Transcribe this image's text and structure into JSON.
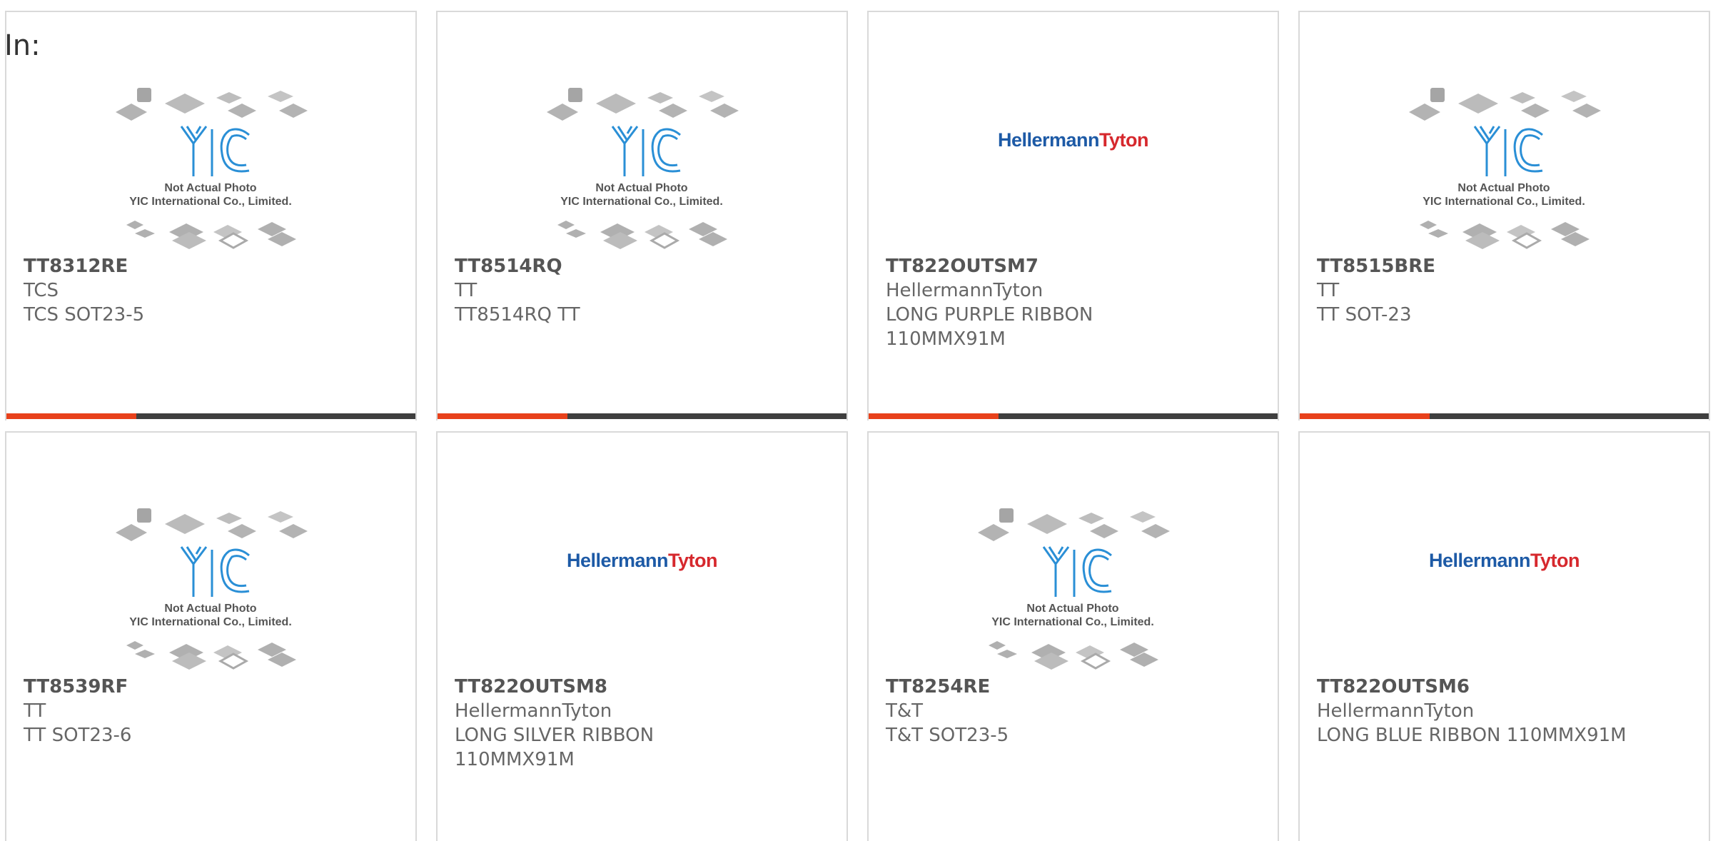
{
  "filter_label": "In:",
  "placeholder": {
    "caption_line1": "Not Actual Photo",
    "caption_line2": "YIC International Co., Limited.",
    "logo_text": "YIC"
  },
  "brand_logo": {
    "part1": "Hellermann",
    "part2": "Tyton"
  },
  "colors": {
    "accent": "#e8411b",
    "bar": "#3f3f3f",
    "logo_blue": "#1d5aa6",
    "logo_red": "#d6282d"
  },
  "products": [
    {
      "part": "TT8312RE",
      "mfr": "TCS",
      "desc": "TCS SOT23-5",
      "image": "yic-placeholder"
    },
    {
      "part": "TT8514RQ",
      "mfr": "TT",
      "desc": "TT8514RQ TT",
      "image": "yic-placeholder"
    },
    {
      "part": "TT822OUTSM7",
      "mfr": "HellermannTyton",
      "desc": "LONG PURPLE RIBBON 110MMX91M",
      "image": "hellermanntyton-logo"
    },
    {
      "part": "TT8515BRE",
      "mfr": "TT",
      "desc": "TT SOT-23",
      "image": "yic-placeholder"
    },
    {
      "part": "TT8539RF",
      "mfr": "TT",
      "desc": "TT SOT23-6",
      "image": "yic-placeholder"
    },
    {
      "part": "TT822OUTSM8",
      "mfr": "HellermannTyton",
      "desc": "LONG SILVER RIBBON 110MMX91M",
      "image": "hellermanntyton-logo"
    },
    {
      "part": "TT8254RE",
      "mfr": "T&T",
      "desc": "T&T SOT23-5",
      "image": "yic-placeholder"
    },
    {
      "part": "TT822OUTSM6",
      "mfr": "HellermannTyton",
      "desc": "LONG BLUE RIBBON 110MMX91M",
      "image": "hellermanntyton-logo"
    }
  ]
}
